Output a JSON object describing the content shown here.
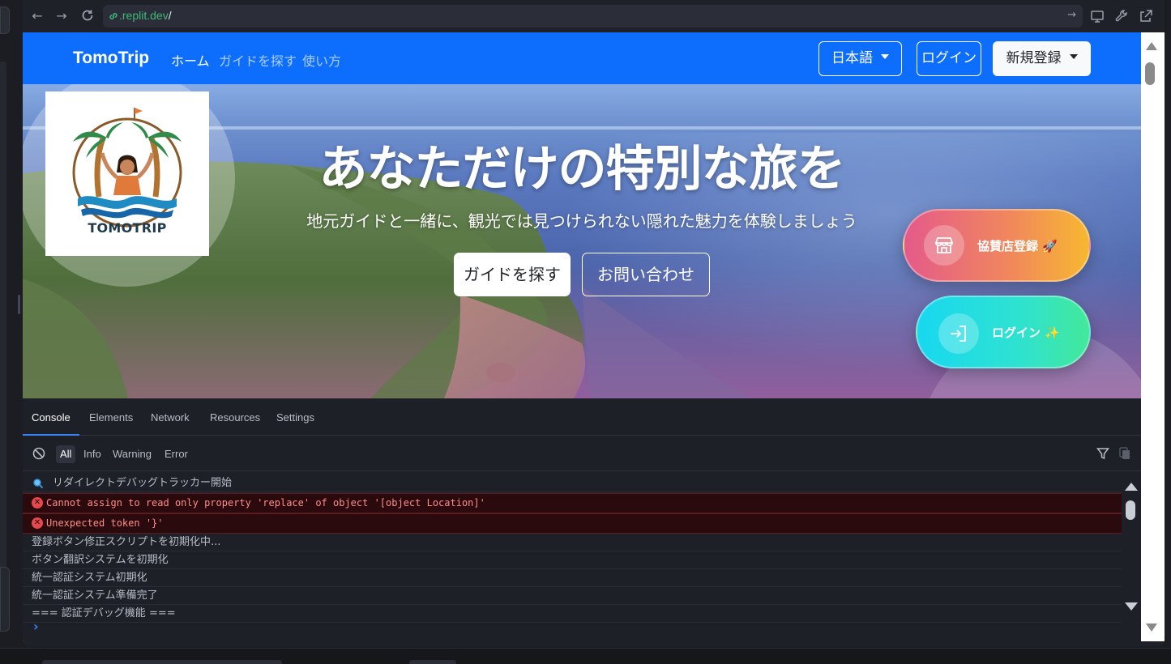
{
  "browser": {
    "url_domain": ".replit.dev",
    "url_path": "/"
  },
  "site": {
    "brand": "TomoTrip",
    "nav_links": [
      "ホーム",
      "ガイドを探す",
      "使い方"
    ],
    "language_button": "日本語",
    "login_button": "ログイン",
    "register_button": "新規登録",
    "logo_text": "TOMOTRIP"
  },
  "hero": {
    "title": "あなただけの特別な旅を",
    "subtitle": "地元ガイドと一緒に、観光では見つけられない隠れた魅力を体験しましょう",
    "primary_button": "ガイドを探す",
    "secondary_button": "お問い合わせ",
    "fab_sponsor": "協賛店登録 🚀",
    "fab_login": "ログイン ✨"
  },
  "devtools": {
    "tabs": [
      "Console",
      "Elements",
      "Network",
      "Resources",
      "Settings"
    ],
    "filters": [
      "All",
      "Info",
      "Warning",
      "Error"
    ],
    "logs": [
      {
        "type": "info",
        "text": "リダイレクトデバッグトラッカー開始"
      },
      {
        "type": "error",
        "text": "Cannot assign to read only property 'replace' of object '[object Location]'"
      },
      {
        "type": "error",
        "text": "Unexpected token '}'"
      },
      {
        "type": "log",
        "text": "登録ボタン修正スクリプトを初期化中..."
      },
      {
        "type": "log",
        "text": "ボタン翻訳システムを初期化"
      },
      {
        "type": "log",
        "text": "統一認証システム初期化"
      },
      {
        "type": "log",
        "text": "統一認証システム準備完了"
      },
      {
        "type": "log",
        "text": "=== 認証デバッグ機能 ==="
      }
    ]
  },
  "colors": {
    "navbar": "#0d6efd",
    "error_bg": "#2a0a0c",
    "error_text": "#ff8c8c"
  }
}
